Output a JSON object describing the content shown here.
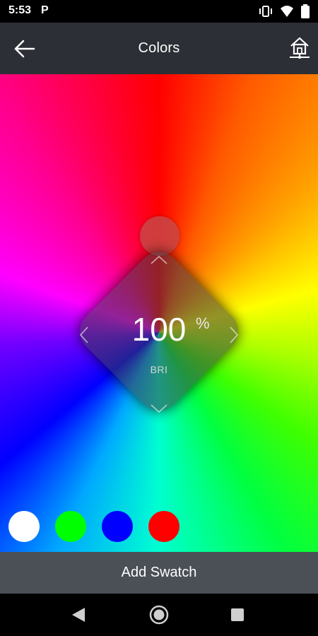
{
  "status_bar": {
    "time": "5:53",
    "app_icon_letter": "P"
  },
  "app_bar": {
    "title": "Colors"
  },
  "brightness": {
    "value": "100",
    "unit": "%",
    "label": "BRI"
  },
  "swatches": [
    {
      "color": "#ffffff"
    },
    {
      "color": "#00ff00"
    },
    {
      "color": "#0000ff"
    },
    {
      "color": "#ff0000"
    }
  ],
  "add_swatch_label": "Add Swatch",
  "icons": {
    "back": "arrow-left-icon",
    "home": "home-network-icon",
    "nav_back": "triangle-back-icon",
    "nav_home": "circle-home-icon",
    "nav_recents": "square-recents-icon"
  }
}
